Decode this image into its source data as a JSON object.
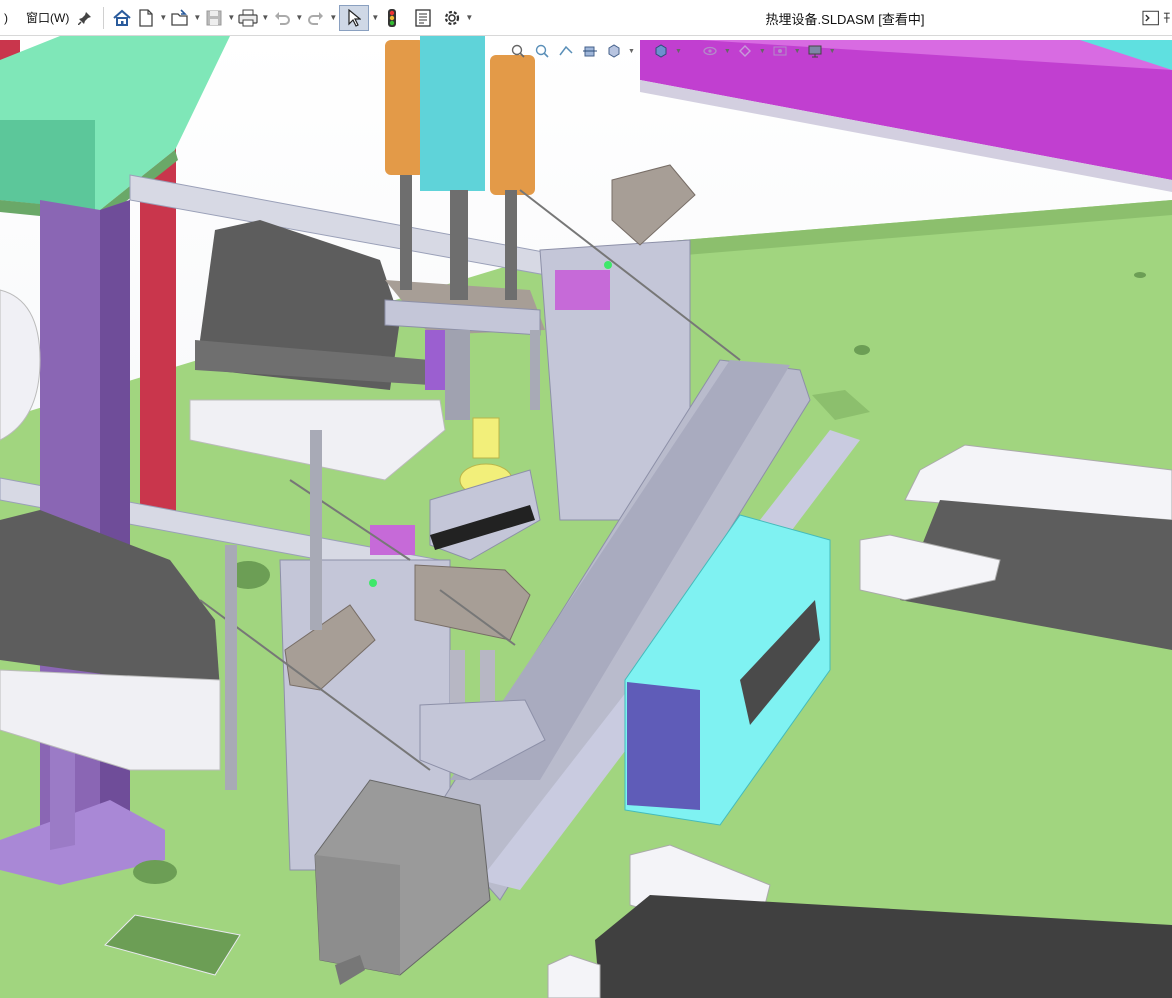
{
  "menu": {
    "left_fragment": ")",
    "window_label": "窗口(W)"
  },
  "document": {
    "title": "热埋设备.SLDASM [查看中]"
  },
  "toolbar": {
    "icons": [
      "pin-icon",
      "home-icon",
      "new-file-icon",
      "open-file-icon",
      "save-icon",
      "print-icon",
      "undo-icon",
      "redo-icon",
      "select-icon",
      "traffic-light-icon",
      "file-properties-icon",
      "options-gear-icon"
    ]
  },
  "hud": {
    "icons": [
      "zoom-to-fit-icon",
      "zoom-area-icon",
      "previous-view-icon",
      "section-view-icon",
      "view-orientation-icon",
      "display-style-icon",
      "hide-show-icon",
      "edit-appearance-icon",
      "apply-scene-icon",
      "view-settings-icon"
    ]
  },
  "colors": {
    "ground": "#a1d57f",
    "machine_gray": "#c4c6d8",
    "purple_column": "#8a66b4",
    "cyan_box": "#7ff2f2",
    "blue_panel": "#5f5cb8",
    "orange_cylinder": "#e39a48",
    "magenta_beam": "#c13fd0",
    "teal_block": "#7fe7b8",
    "red_frame": "#c9364c",
    "yellow_part": "#f2ef7a",
    "dark_gray": "#5d5d5d"
  }
}
